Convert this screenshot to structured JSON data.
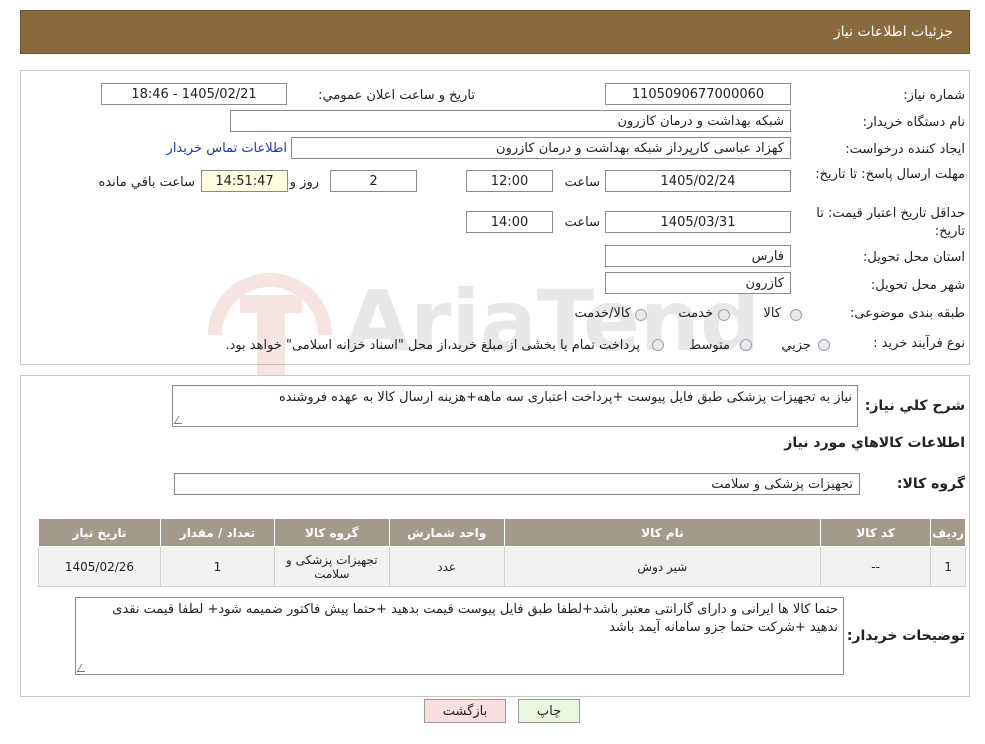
{
  "header": {
    "title": "جزئیات اطلاعات نیاز"
  },
  "watermark": {
    "text": "AriaTender.neT"
  },
  "info": {
    "need_number_label": "شماره نیاز:",
    "need_number": "1105090677000060",
    "announce_label": "تاریخ و ساعت اعلان عمومي:",
    "announce_value": "1405/02/21 - 18:46",
    "buyer_org_label": "نام دستگاه خریدار:",
    "buyer_org": "شبکه بهداشت و درمان کازرون",
    "creator_label": "ایجاد کننده درخواست:",
    "creator": "کهزاد عباسی کارپرداز شبکه بهداشت و درمان کازرون",
    "contact_link": "اطلاعات تماس خریدار",
    "deadline_label": "مهلت ارسال پاسخ: تا تاریخ:",
    "deadline_date": "1405/02/24",
    "time_label": "ساعت",
    "deadline_time": "12:00",
    "days_value": "2",
    "days_label": "روز و",
    "remaining_time": "14:51:47",
    "remaining_label": "ساعت باقي مانده",
    "validity_label": "حداقل تاریخ اعتبار قیمت: تا تاریخ:",
    "validity_date": "1405/03/31",
    "validity_time": "14:00",
    "province_label": "استان محل تحویل:",
    "province": "فارس",
    "city_label": "شهر محل تحویل:",
    "city": "کازرون",
    "category_label": "طبقه بندی موضوعی:",
    "category_options": [
      "کالا",
      "خدمت",
      "کالا/خدمت"
    ],
    "process_label": "نوع فرآیند خرید :",
    "process_options": [
      "جزیي",
      "متوسط"
    ],
    "process_note": "پرداخت تمام یا بخشی از مبلغ خرید،از محل \"اسناد خزانه اسلامی\" خواهد بود."
  },
  "details": {
    "summary_label": "شرح کلي نیاز:",
    "summary": "نیاز به تجهیزات پزشکی طبق فایل پیوست +پرداخت اعتباری سه ماهه+هزینه ارسال کالا به عهده فروشنده",
    "goods_info_title": "اطلاعات کالاهاي مورد نیاز",
    "goods_group_label": "گروه کالا:",
    "goods_group": "تجهیزات پزشکی و سلامت",
    "table": {
      "headers": [
        "ردیف",
        "کد کالا",
        "نام کالا",
        "واحد شمارش",
        "گروه کالا",
        "تعداد / مقدار",
        "تاریخ نیاز"
      ],
      "rows": [
        [
          "1",
          "--",
          "شیر دوش",
          "عدد",
          "تجهیزات پزشکی و سلامت",
          "1",
          "1405/02/26"
        ]
      ]
    },
    "buyer_notes_label": "توضیحات خریدار:",
    "buyer_notes": "حتما کالا ها ایرانی و دارای گارانتی معتبر باشد+لطفا طبق فایل پیوست قیمت بدهید +حتما پیش فاکتور ضمیمه شود+ لطفا قیمت نقدی ندهید +شرکت حتما جزو سامانه آیمد باشد"
  },
  "buttons": {
    "print": "چاپ",
    "back": "بازگشت"
  },
  "colors": {
    "header_bg": "#896a3c",
    "table_header": "#a39a8a",
    "back_btn": "#fbdede",
    "print_btn": "#e9f7df"
  }
}
